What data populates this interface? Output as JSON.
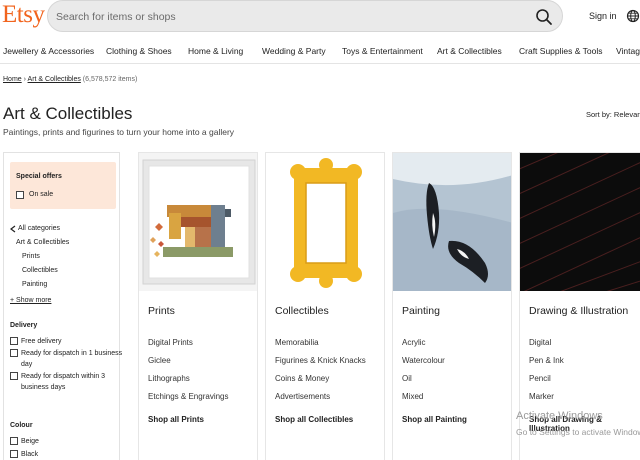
{
  "header": {
    "logo": "Etsy",
    "search_placeholder": "Search for items or shops",
    "sign_in": "Sign in"
  },
  "categories": [
    "Jewellery & Accessories",
    "Clothing & Shoes",
    "Home & Living",
    "Wedding & Party",
    "Toys & Entertainment",
    "Art & Collectibles",
    "Craft Supplies & Tools",
    "Vintage"
  ],
  "breadcrumb": {
    "home": "Home",
    "sep": "›",
    "current": "Art & Collectibles",
    "count": "(6,578,572 items)"
  },
  "page": {
    "title": "Art & Collectibles",
    "subtitle": "Paintings, prints and figurines to turn your home into a gallery",
    "sort": "Sort by: Relevancy"
  },
  "sidebar": {
    "offers_title": "Special offers",
    "on_sale": "On sale",
    "all_categories": "All categories",
    "current_category": "Art & Collectibles",
    "subcategories": [
      "Prints",
      "Collectibles",
      "Painting"
    ],
    "show_more": "+ Show more",
    "delivery_title": "Delivery",
    "delivery_options": [
      "Free delivery",
      "Ready for dispatch in 1 business",
      "day",
      "Ready for dispatch within 3",
      "business days"
    ],
    "colour_title": "Colour",
    "colours": [
      "Beige",
      "Black"
    ]
  },
  "cards": [
    {
      "title": "Prints",
      "links": [
        "Digital Prints",
        "Giclee",
        "Lithographs",
        "Etchings & Engravings"
      ],
      "shop_all": "Shop all Prints"
    },
    {
      "title": "Collectibles",
      "links": [
        "Memorabilia",
        "Figurines & Knick Knacks",
        "Coins & Money",
        "Advertisements"
      ],
      "shop_all": "Shop all Collectibles"
    },
    {
      "title": "Painting",
      "links": [
        "Acrylic",
        "Watercolour",
        "Oil",
        "Mixed"
      ],
      "shop_all": "Shop all Painting"
    },
    {
      "title": "Drawing & Illustration",
      "links": [
        "Digital",
        "Pen & Ink",
        "Pencil",
        "Marker"
      ],
      "shop_all_1": "Shop all Drawing &",
      "shop_all_2": "Illustration"
    }
  ],
  "watermark": {
    "line1": "Activate Windows",
    "line2": "Go to Settings to activate Windows."
  },
  "colors": {
    "brand": "#f1641e",
    "offers_bg": "#fde7d9"
  }
}
